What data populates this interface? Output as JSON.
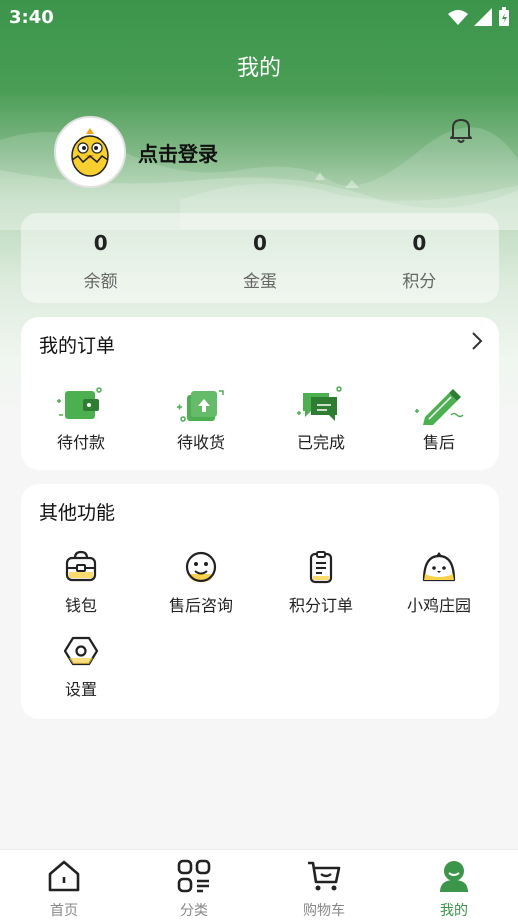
{
  "status_bar": {
    "time": "3:40"
  },
  "header": {
    "title": "我的"
  },
  "profile": {
    "login_label": "点击登录"
  },
  "stats": [
    {
      "value": "0",
      "label": "余额"
    },
    {
      "value": "0",
      "label": "金蛋"
    },
    {
      "value": "0",
      "label": "积分"
    }
  ],
  "orders": {
    "title": "我的订单",
    "items": [
      {
        "label": "待付款",
        "icon": "wallet-icon"
      },
      {
        "label": "待收货",
        "icon": "package-icon"
      },
      {
        "label": "已完成",
        "icon": "chat-check-icon"
      },
      {
        "label": "售后",
        "icon": "pencil-icon"
      }
    ]
  },
  "functions": {
    "title": "其他功能",
    "items": [
      {
        "label": "钱包",
        "icon": "bag-icon"
      },
      {
        "label": "售后咨询",
        "icon": "smile-icon"
      },
      {
        "label": "积分订单",
        "icon": "clipboard-icon"
      },
      {
        "label": "小鸡庄园",
        "icon": "chick-icon"
      },
      {
        "label": "设置",
        "icon": "hex-nut-icon"
      }
    ]
  },
  "nav": [
    {
      "label": "首页",
      "icon": "home-icon"
    },
    {
      "label": "分类",
      "icon": "category-icon"
    },
    {
      "label": "购物车",
      "icon": "cart-icon"
    },
    {
      "label": "我的",
      "icon": "user-icon",
      "active": true
    }
  ],
  "colors": {
    "brand": "#3b954a",
    "icon_yellow": "#f7d24a"
  }
}
